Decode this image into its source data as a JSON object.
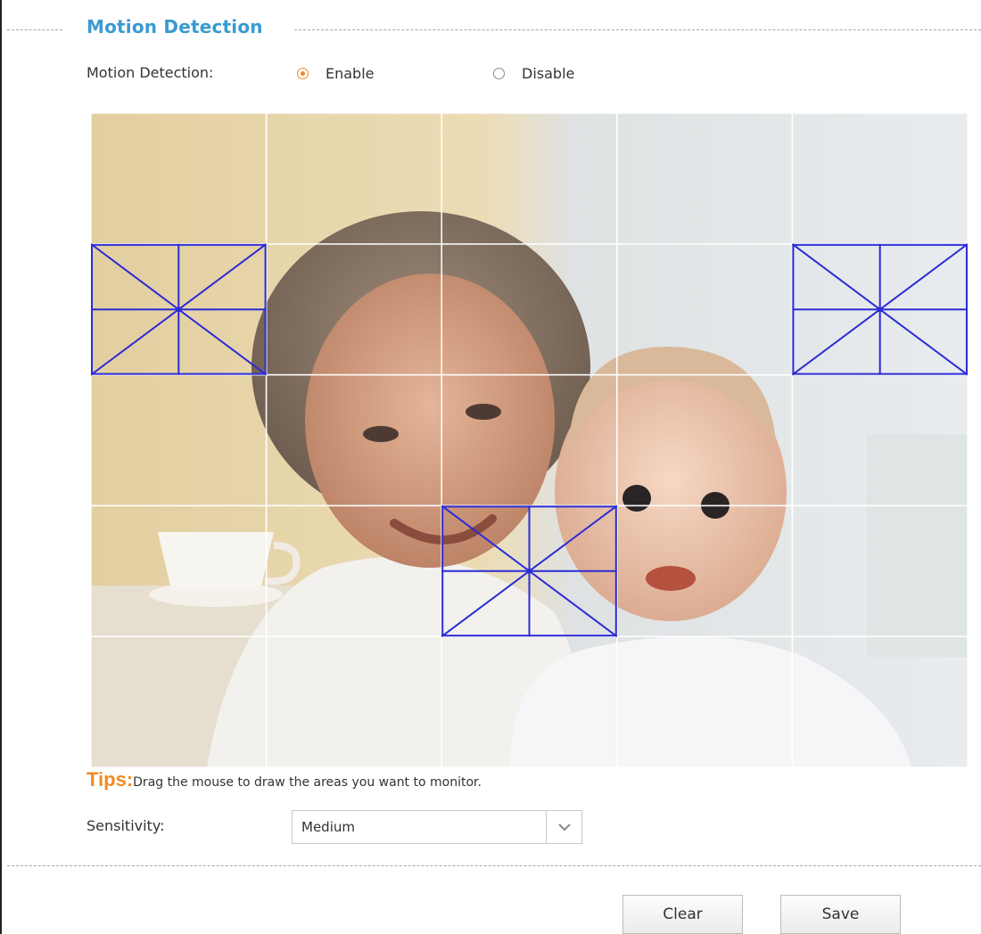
{
  "section": {
    "title": "Motion Detection"
  },
  "motion_detection": {
    "label": "Motion Detection:",
    "options": [
      {
        "label": "Enable",
        "selected": true
      },
      {
        "label": "Disable",
        "selected": false
      }
    ]
  },
  "grid": {
    "columns": 5,
    "rows": 5,
    "selected_cells": [
      {
        "row": 1,
        "col": 0
      },
      {
        "row": 1,
        "col": 4
      },
      {
        "row": 3,
        "col": 2
      }
    ]
  },
  "tips": {
    "title": "Tips:",
    "text": "Drag the mouse to draw the areas you want to monitor."
  },
  "sensitivity": {
    "label": "Sensitivity:",
    "value": "Medium"
  },
  "buttons": {
    "clear": "Clear",
    "save": "Save"
  },
  "colors": {
    "accent_title": "#3a9bd0",
    "accent_orange": "#f08a24",
    "selection_outline": "#2b2bd6",
    "grid_line": "#ffffff"
  },
  "icons": {
    "dropdown": "chevron-down-icon"
  }
}
